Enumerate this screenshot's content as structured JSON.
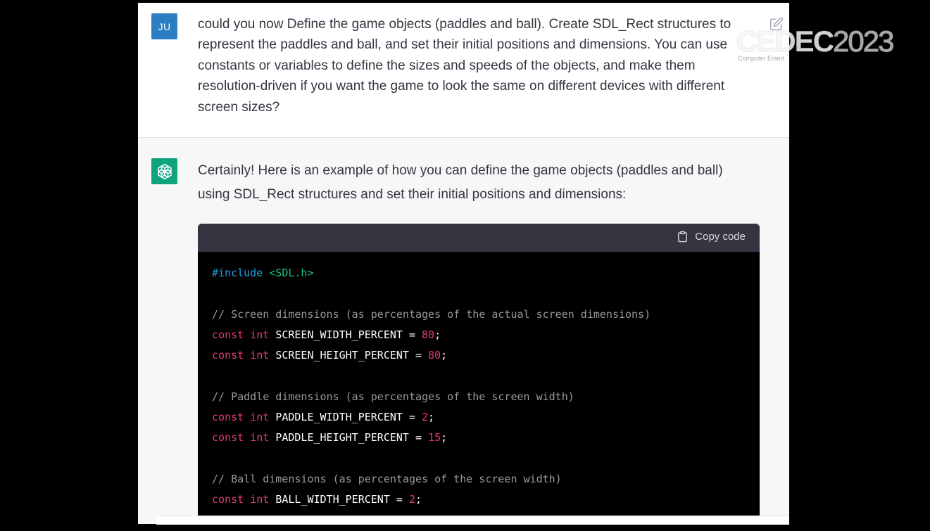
{
  "user_message": {
    "avatar_initials": "JU",
    "text": "could you now Define the game objects (paddles and ball). Create SDL_Rect structures to represent the paddles and ball, and set their initial positions and dimensions. You can use constants or variables to define the sizes and speeds of the objects, and make them resolution-driven if you want the game to look the same on different devices with different screen sizes?",
    "edit_icon": "edit-icon"
  },
  "assistant_message": {
    "avatar_icon": "openai-logo-icon",
    "intro": "Certainly! Here is an example of how you can define the game objects (paddles and ball) using SDL_Rect structures and set their initial positions and dimensions:",
    "code_block": {
      "copy_label": "Copy code",
      "copy_icon": "clipboard-icon",
      "include": {
        "directive": "#include",
        "file": "<SDL.h>"
      },
      "comment_screen": "// Screen dimensions (as percentages of the actual screen dimensions)",
      "comment_paddle": "// Paddle dimensions (as percentages of the screen width)",
      "comment_ball": "// Ball dimensions (as percentages of the screen width)",
      "kw_const": "const",
      "kw_int": "int",
      "eq": "=",
      "semi": ";",
      "constants": [
        {
          "name": "SCREEN_WIDTH_PERCENT",
          "value": "80"
        },
        {
          "name": "SCREEN_HEIGHT_PERCENT",
          "value": "80"
        },
        {
          "name": "PADDLE_WIDTH_PERCENT",
          "value": "2"
        },
        {
          "name": "PADDLE_HEIGHT_PERCENT",
          "value": "15"
        },
        {
          "name": "BALL_WIDTH_PERCENT",
          "value": "2"
        }
      ]
    }
  },
  "watermark": {
    "main": "CEDEC",
    "year": "2023",
    "sub": "Computer Entert"
  },
  "colors": {
    "user_avatar": "#2b7ec1",
    "bot_avatar": "#10a37f",
    "code_bg": "#000000",
    "code_header": "#343541",
    "keyword": "#e33a6f",
    "string": "#19c37d",
    "preprocessor": "#1ea4e9",
    "comment": "#9a9aa0"
  }
}
